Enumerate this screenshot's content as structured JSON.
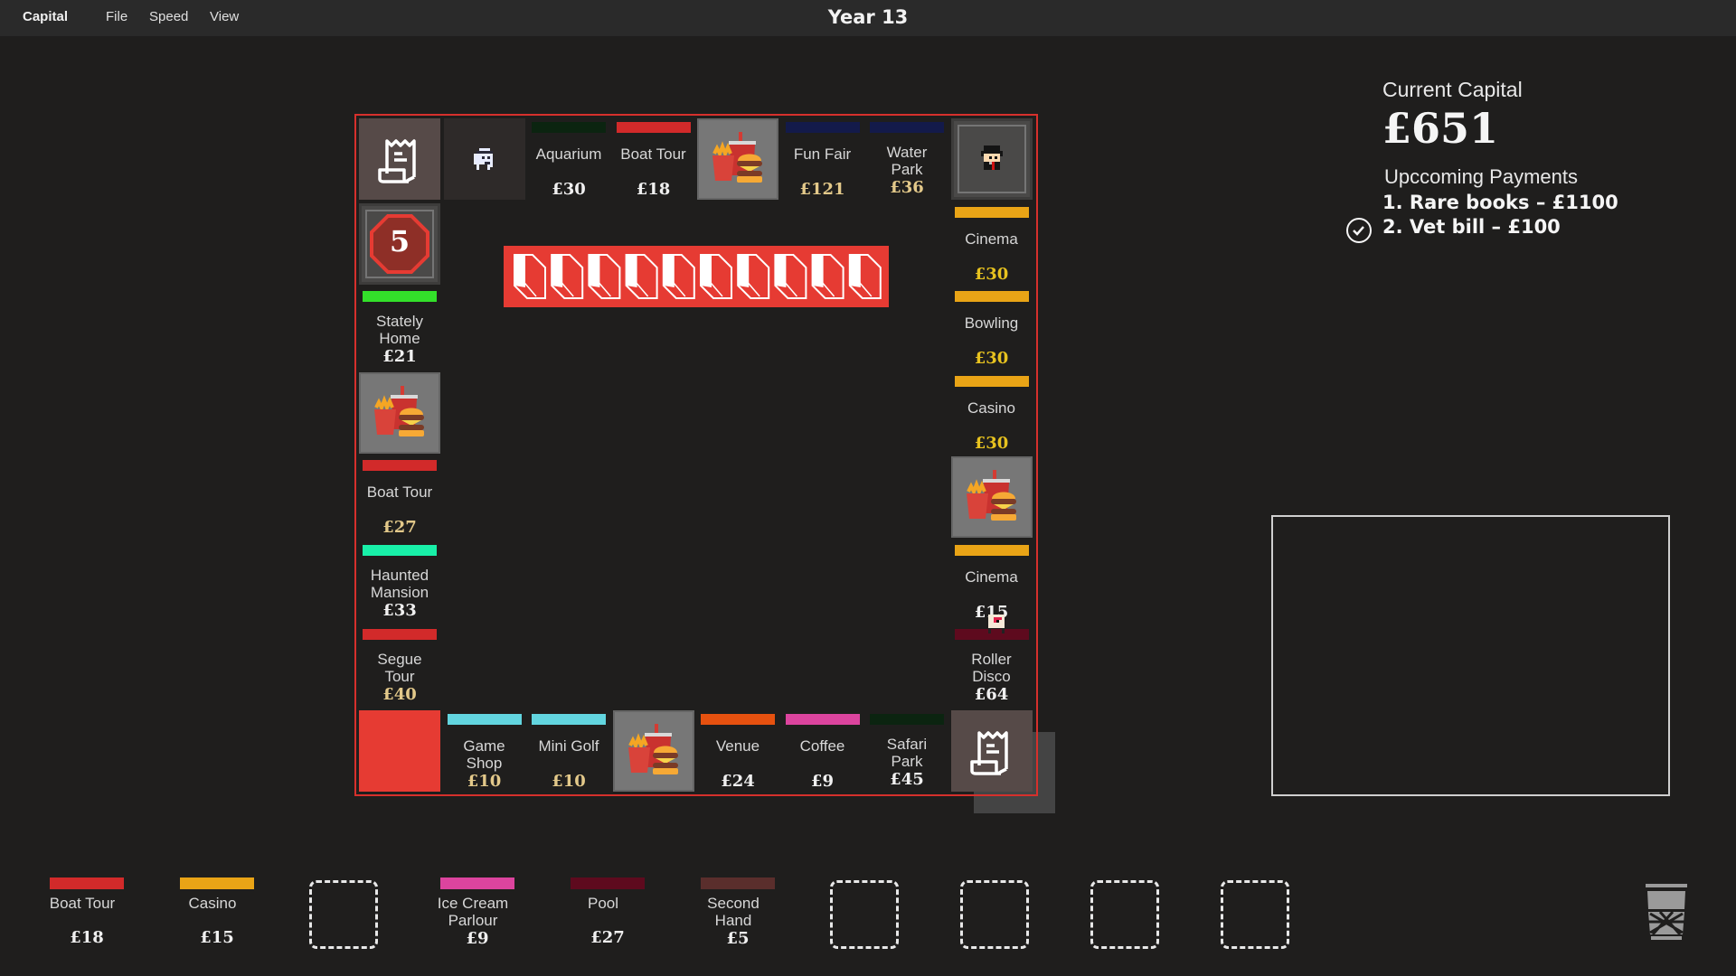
{
  "menubar": {
    "app_name": "Capital",
    "menus": [
      "File",
      "Speed",
      "View"
    ],
    "title": "Year 13"
  },
  "colors": {
    "accent_red": "#e63b33",
    "board_border": "#d6302c",
    "price_white": "#f0f0f0",
    "price_gold": "#e3c98a",
    "price_yellow": "#e7c21f"
  },
  "board": {
    "logo_text": "CAPITALISM",
    "top_row": [
      {
        "type": "receipt",
        "icon": "receipt-icon"
      },
      {
        "type": "character",
        "icon": "robot-character-icon"
      },
      {
        "type": "property",
        "name": "Aquarium",
        "price": "£30",
        "bar_color": "#0b2410",
        "price_color": "#f0f0f0"
      },
      {
        "type": "property",
        "name": "Boat Tour",
        "price": "£18",
        "bar_color": "#d22a2a",
        "price_color": "#f0f0f0"
      },
      {
        "type": "food",
        "icon": "fast-food-icon"
      },
      {
        "type": "property",
        "name": "Fun Fair",
        "price": "£121",
        "bar_color": "#131a4a",
        "price_color": "#e3c98a"
      },
      {
        "type": "property",
        "name": "Water Park",
        "price": "£36",
        "bar_color": "#131a4a",
        "price_color": "#e3c98a"
      },
      {
        "type": "character",
        "icon": "businessman-character-icon"
      }
    ],
    "left_column": [
      {
        "type": "dice",
        "value": "5"
      },
      {
        "type": "property",
        "name": "Stately Home",
        "price": "£21",
        "bar_color": "#33e02a",
        "price_color": "#f0f0f0"
      },
      {
        "type": "food",
        "icon": "fast-food-icon"
      },
      {
        "type": "property",
        "name": "Boat Tour",
        "price": "£27",
        "bar_color": "#d22a2a",
        "price_color": "#e3c98a"
      },
      {
        "type": "property",
        "name": "Haunted Mansion",
        "price": "£33",
        "bar_color": "#18f0a8",
        "price_color": "#f0f0f0"
      },
      {
        "type": "property",
        "name": "Segue Tour",
        "price": "£40",
        "bar_color": "#d22a2a",
        "price_color": "#e3c98a"
      }
    ],
    "right_column": [
      {
        "type": "property",
        "name": "Cinema",
        "price": "£30",
        "bar_color": "#e9a416",
        "price_color": "#e7c21f"
      },
      {
        "type": "property",
        "name": "Bowling",
        "price": "£30",
        "bar_color": "#e9a416",
        "price_color": "#e7c21f"
      },
      {
        "type": "property",
        "name": "Casino",
        "price": "£30",
        "bar_color": "#e9a416",
        "price_color": "#e7c21f"
      },
      {
        "type": "food",
        "icon": "fast-food-icon"
      },
      {
        "type": "property",
        "name": "Cinema",
        "price": "£15",
        "bar_color": "#e9a416",
        "price_color": "#f0f0f0"
      },
      {
        "type": "property",
        "name": "Roller Disco",
        "price": "£64",
        "bar_color": "#5e0a1e",
        "price_color": "#f0f0f0"
      }
    ],
    "bottom_row": [
      {
        "type": "start",
        "color": "#e63b33"
      },
      {
        "type": "property",
        "name": "Game Shop",
        "price": "£10",
        "bar_color": "#62d5df",
        "price_color": "#e3c98a"
      },
      {
        "type": "property",
        "name": "Mini Golf",
        "price": "£10",
        "bar_color": "#62d5df",
        "price_color": "#e3c98a"
      },
      {
        "type": "food",
        "icon": "fast-food-icon"
      },
      {
        "type": "property",
        "name": "Venue",
        "price": "£24",
        "bar_color": "#e6510f",
        "price_color": "#f0f0f0"
      },
      {
        "type": "property",
        "name": "Coffee",
        "price": "£9",
        "bar_color": "#dc449e",
        "price_color": "#f0f0f0"
      },
      {
        "type": "property",
        "name": "Safari Park",
        "price": "£45",
        "bar_color": "#0b2410",
        "price_color": "#f0f0f0"
      },
      {
        "type": "receipt",
        "icon": "receipt-icon"
      }
    ]
  },
  "panel": {
    "capital_label": "Current Capital",
    "capital_value": "£651",
    "payments_label": "Upccoming Payments",
    "payments": [
      {
        "text": "1. Rare books – £1100",
        "checked": false
      },
      {
        "text": "2. Vet bill – £100",
        "checked": true
      }
    ]
  },
  "hand": [
    {
      "type": "card",
      "name": "Boat Tour",
      "price": "£18",
      "bar_color": "#d22a2a"
    },
    {
      "type": "card",
      "name": "Casino",
      "price": "£15",
      "bar_color": "#e9a416"
    },
    {
      "type": "empty"
    },
    {
      "type": "card",
      "name": "Ice Cream Parlour",
      "price": "£9",
      "bar_color": "#dc449e"
    },
    {
      "type": "card",
      "name": "Pool",
      "price": "£27",
      "bar_color": "#5e0a1e"
    },
    {
      "type": "card",
      "name": "Second Hand",
      "price": "£5",
      "bar_color": "#5a2e2c"
    },
    {
      "type": "empty"
    },
    {
      "type": "empty"
    },
    {
      "type": "empty"
    },
    {
      "type": "empty"
    }
  ],
  "trash_icon": "trash-bin-icon"
}
